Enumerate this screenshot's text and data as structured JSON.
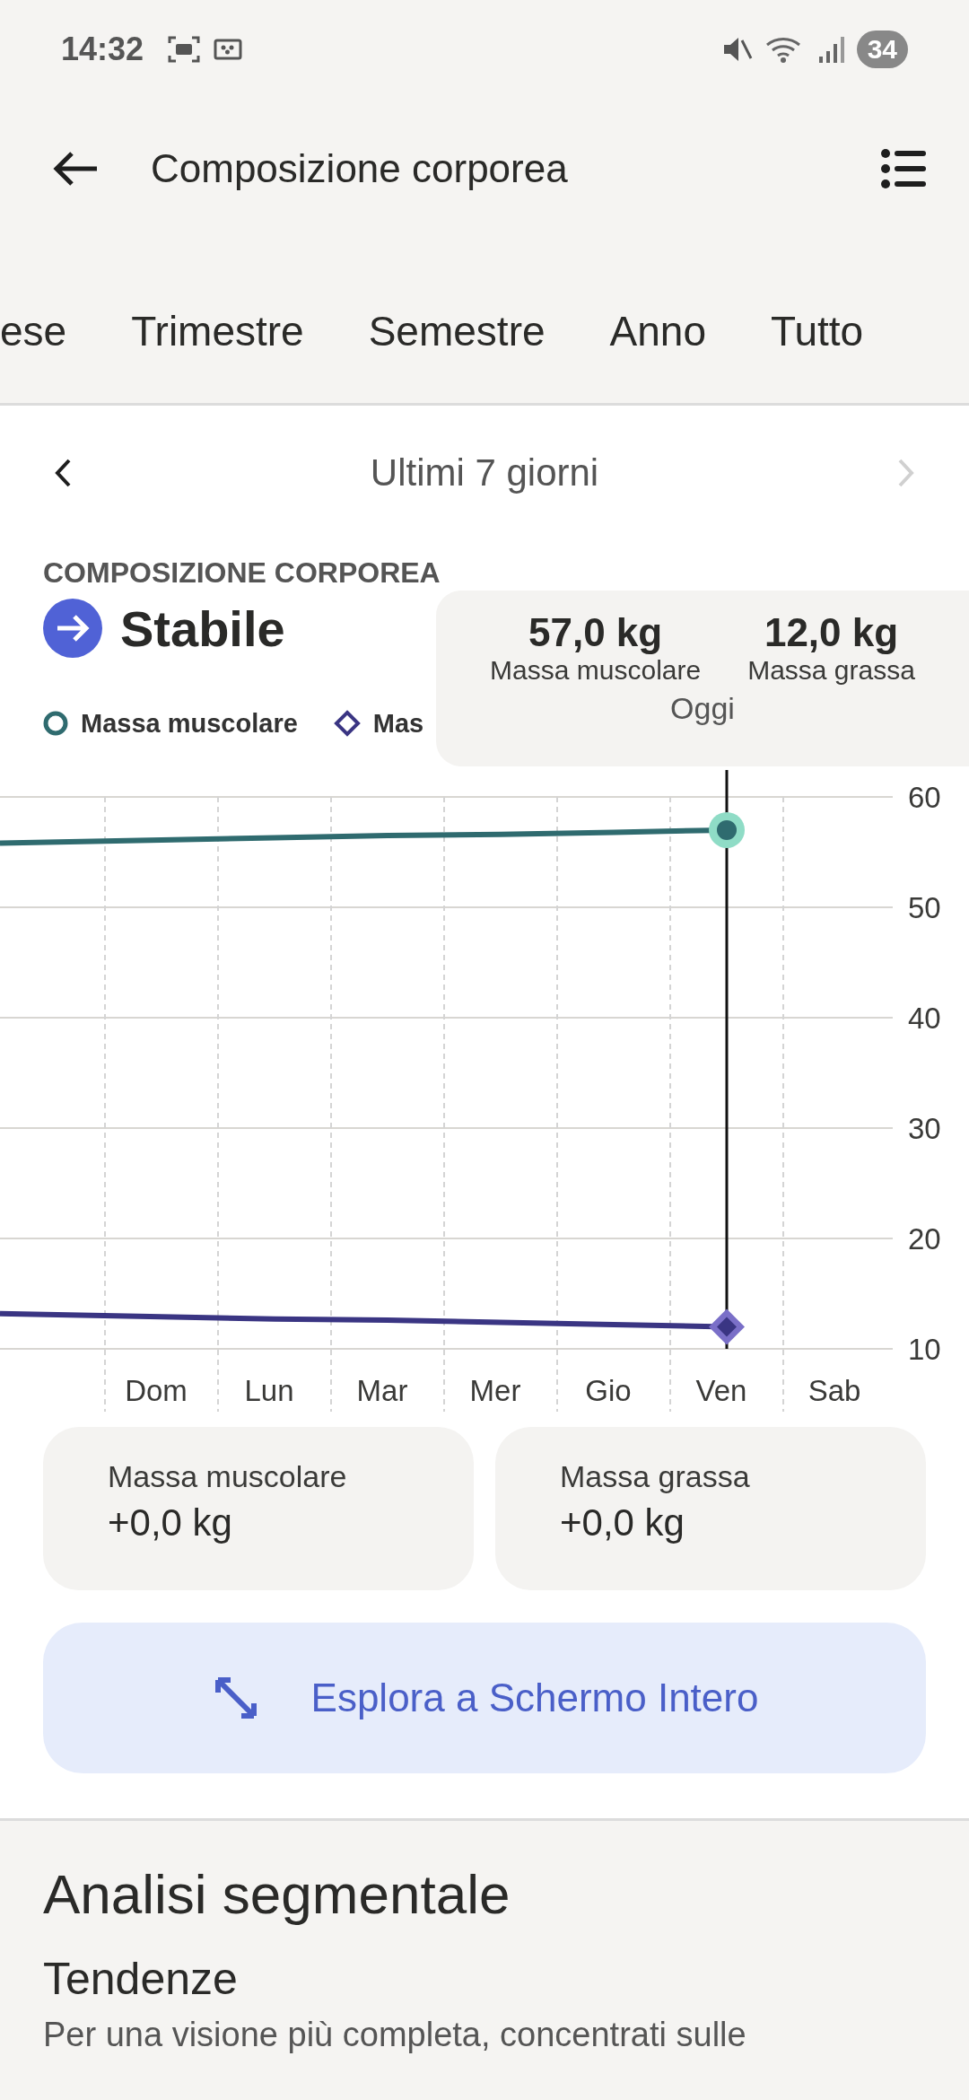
{
  "status_bar": {
    "time": "14:32",
    "battery": "34"
  },
  "header": {
    "title": "Composizione corporea"
  },
  "tabs": [
    {
      "label": "ese",
      "selected": false
    },
    {
      "label": "Trimestre",
      "selected": false
    },
    {
      "label": "Semestre",
      "selected": false
    },
    {
      "label": "Anno",
      "selected": false
    },
    {
      "label": "Tutto",
      "selected": false
    }
  ],
  "period": {
    "label": "Ultimi 7 giorni",
    "next_disabled": true
  },
  "summary": {
    "overline": "COMPOSIZIONE CORPOREA",
    "trend": "Stabile"
  },
  "legend": [
    {
      "label": "Massa muscolare",
      "kind": "circle",
      "color": "#2f6b6f"
    },
    {
      "label": "Mas",
      "kind": "diamond",
      "color": "#3a3583"
    }
  ],
  "tooltip": {
    "values": [
      "57,0 kg",
      "12,0 kg"
    ],
    "date": "Oggi"
  },
  "chart_data": {
    "type": "line",
    "grid": true,
    "ref_lines": [
      {
        "axis": "x",
        "value": "Ven"
      }
    ],
    "categories": [
      "Dom",
      "Lun",
      "Mar",
      "Mer",
      "Gio",
      "Ven",
      "Sab"
    ],
    "yticks": [
      10,
      20,
      30,
      40,
      50,
      60
    ],
    "ylim": [
      10,
      60
    ],
    "series": [
      {
        "name": "Massa muscolare",
        "color": "#2f6b6f",
        "values": [
          56.1,
          56.3,
          56.5,
          56.6,
          56.8,
          57.0,
          null
        ]
      },
      {
        "name": "Massa grassa",
        "color": "#3a3583",
        "values": [
          12.9,
          12.7,
          12.6,
          12.4,
          12.2,
          12.0,
          null
        ]
      }
    ]
  },
  "changes": [
    {
      "label": "Massa muscolare",
      "value": "+0,0 kg"
    },
    {
      "label": "Massa grassa",
      "value": "+0,0 kg"
    }
  ],
  "fullscreen_button": {
    "label": "Esplora a Schermo Intero"
  },
  "segment": {
    "title": "Analisi segmentale",
    "subtitle": "Tendenze",
    "text": "Per una visione più completa, concentrati sulle"
  }
}
